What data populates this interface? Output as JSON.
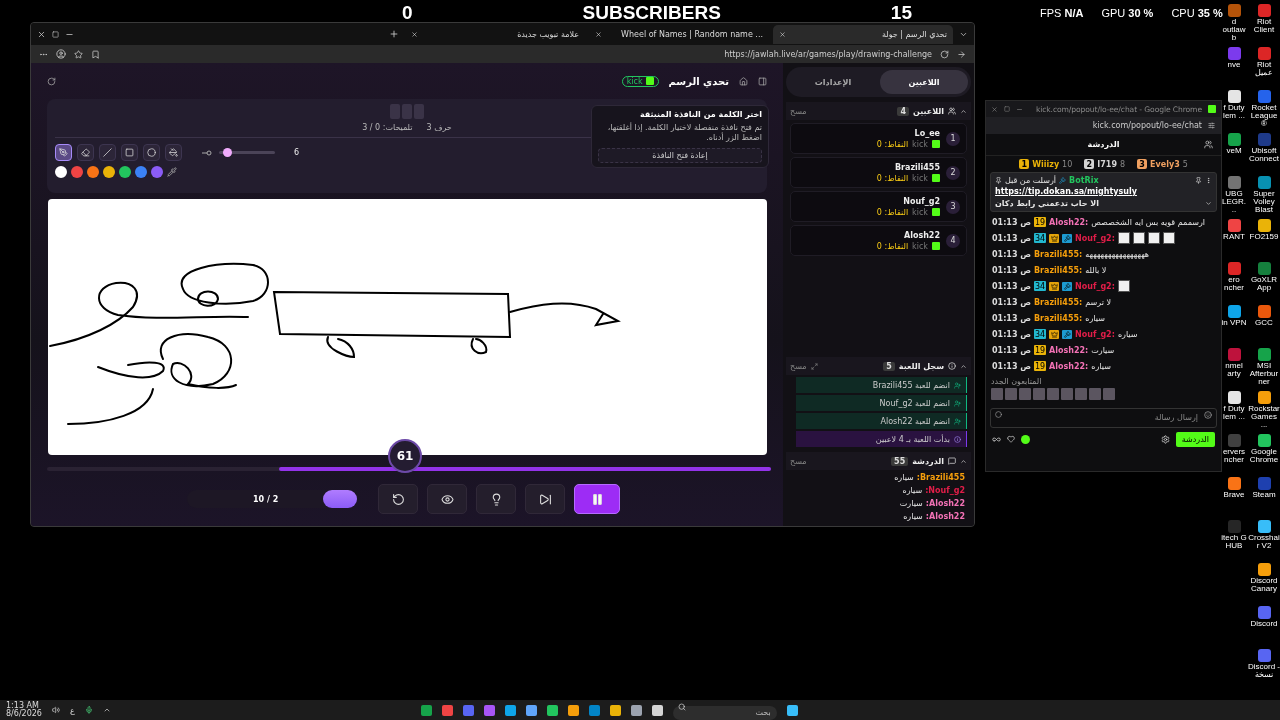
{
  "stream_overlay": {
    "left_count": "0",
    "title": "SUBSCRIBERS",
    "right_count": "15"
  },
  "perf": [
    "CPU **35 %**",
    "GPU **30 %**",
    "FPS **N/A**"
  ],
  "browser": {
    "tabs": [
      {
        "title": "تحدي الرسم | جولة",
        "selected": true
      },
      {
        "title": "Wheel of Names | Random name ...",
        "selected": false
      },
      {
        "title": "علامة تبويب جديدة",
        "selected": false
      }
    ],
    "url": "https://jawlah.live/ar/games/play/drawing-challenge"
  },
  "game": {
    "title": "تحدي الرسم",
    "platform": "kick",
    "word": {
      "letters": "3 حرف",
      "hints": "تلميحات: 0 / 3"
    },
    "tools": [
      {
        "kind": "pen",
        "selected": true
      },
      {
        "kind": "eraser",
        "selected": false
      },
      {
        "kind": "line",
        "selected": false
      },
      {
        "kind": "rect",
        "selected": false
      },
      {
        "kind": "circle",
        "selected": false
      },
      {
        "kind": "fill",
        "selected": false
      }
    ],
    "brush": {
      "level": 0.15,
      "value": "6"
    },
    "colors": [
      {
        "color": "#ffffff",
        "selected": true
      },
      {
        "color": "#ef4444",
        "selected": false
      },
      {
        "color": "#f97316",
        "selected": false
      },
      {
        "color": "#eab308",
        "selected": false
      },
      {
        "color": "#22c55e",
        "selected": false
      },
      {
        "color": "#3b82f6",
        "selected": false
      },
      {
        "color": "#8b5cf6",
        "selected": false
      }
    ],
    "popup": {
      "title": "اختر الكلمة من النافذة المنبثقة",
      "body": "تم فتح نافذة منفصلة لاختيار الكلمة. إذا أغلقتها، اضغط الزر أدناه.",
      "button": "إعادة فتح النافذة"
    },
    "timer": "61",
    "progress": {
      "level": 0.68
    },
    "round": "10 / 2",
    "controls": [
      {
        "kind": "restart",
        "selected": false
      },
      {
        "kind": "reveal",
        "selected": false
      },
      {
        "kind": "hint",
        "selected": false
      },
      {
        "kind": "skip",
        "selected": false
      },
      {
        "kind": "pause",
        "selected": true
      }
    ]
  },
  "sidebar": {
    "tabs": [
      {
        "label": "اللاعبين",
        "selected": true
      },
      {
        "label": "الإعدادات",
        "selected": false
      }
    ],
    "players": {
      "title": "اللاعبين",
      "count": "4",
      "clear": "مسح",
      "items": [
        {
          "rank": "1",
          "name": "Lo_ee",
          "platform": "kick",
          "points": "النقاط: 0"
        },
        {
          "rank": "2",
          "name": "Brazili455",
          "platform": "kick",
          "points": "النقاط: 0"
        },
        {
          "rank": "3",
          "name": "Nouf_g2",
          "platform": "kick",
          "points": "النقاط: 0"
        },
        {
          "rank": "4",
          "name": "Alosh22",
          "platform": "kick",
          "points": "النقاط: 0"
        }
      ]
    },
    "log": {
      "title": "سجل اللعبة",
      "count": "5",
      "clear": "مسح",
      "items": [
        {
          "kind": "join",
          "text": "Brazili455 انضم للعبة"
        },
        {
          "kind": "join",
          "text": "Nouf_g2 انضم للعبة"
        },
        {
          "kind": "join",
          "text": "Alosh22 انضم للعبة"
        },
        {
          "kind": "info",
          "text": "بدأت اللعبة بـ 4 لاعبين"
        }
      ]
    },
    "chat": {
      "title": "الدردشة",
      "count": "55",
      "clear": "مسح",
      "messages": [
        {
          "name": ":Brazili455",
          "color": "#f59e0b",
          "text": "سياره"
        },
        {
          "name": ":Nouf_g2",
          "color": "#e11d48",
          "text": "سياره"
        },
        {
          "name": ":Alosh22",
          "color": "#f472b6",
          "text": "سيارت"
        },
        {
          "name": ":Alosh22",
          "color": "#f472b6",
          "text": "سياره"
        }
      ]
    }
  },
  "kick_chat": {
    "window_title": "kick.com/popout/lo-ee/chat - Google Chrome",
    "url": "kick.com/popout/lo-ee/chat",
    "title": "الدردشة",
    "leaders": [
      {
        "rank": "3",
        "name": "Evely3",
        "score": "5",
        "color": "#f0a060"
      },
      {
        "rank": "2",
        "name": "I719",
        "score": "8",
        "color": "#d4d4d4"
      },
      {
        "rank": "1",
        "name": "Wiiizy",
        "score": "10",
        "color": "#eab308"
      }
    ],
    "pinned": {
      "author": "BotRix",
      "sent_by": "أرسلت من قبل",
      "link": "https://tip.dokan.sa/mightysuly",
      "text": "الا حاب تدعمني رابط دكان"
    },
    "messages": [
      {
        "time": "01:13 ص",
        "badges": [
          {
            "kind": "sub",
            "label": "19",
            "color": "#eab308"
          }
        ],
        "name": "Alosh22:",
        "color": "#f472b6",
        "kind": "text",
        "text": "ارسممم قويه بس ايه الشخصصص"
      },
      {
        "time": "01:13 ص",
        "badges": [
          {
            "kind": "sub",
            "label": "34",
            "color": "#22b8cf"
          },
          {
            "kind": "crown"
          },
          {
            "kind": "mod"
          }
        ],
        "name": "Nouf_g2:",
        "color": "#e11d48",
        "kind": "emote",
        "emotes": [
          {
            "kind": "emote"
          },
          {
            "kind": "emote"
          },
          {
            "kind": "emote"
          },
          {
            "kind": "emote"
          }
        ]
      },
      {
        "time": "01:13 ص",
        "name": "Brazili455:",
        "color": "#f59e0b",
        "kind": "text",
        "text": "ههههههههههههههههه"
      },
      {
        "time": "01:13 ص",
        "name": "Brazili455:",
        "color": "#f59e0b",
        "kind": "text",
        "text": "لا بالله"
      },
      {
        "time": "01:13 ص",
        "badges": [
          {
            "kind": "sub",
            "label": "34",
            "color": "#22b8cf"
          },
          {
            "kind": "crown"
          },
          {
            "kind": "mod"
          }
        ],
        "name": "Nouf_g2:",
        "color": "#e11d48",
        "kind": "emote",
        "emotes": [
          {
            "kind": "emote"
          }
        ]
      },
      {
        "time": "01:13 ص",
        "name": "Brazili455:",
        "color": "#f59e0b",
        "kind": "text",
        "text": "لا ترسم"
      },
      {
        "time": "01:13 ص",
        "name": "Brazili455:",
        "color": "#f59e0b",
        "kind": "text",
        "text": "سياره"
      },
      {
        "time": "01:13 ص",
        "badges": [
          {
            "kind": "sub",
            "label": "34",
            "color": "#22b8cf"
          },
          {
            "kind": "crown"
          },
          {
            "kind": "mod"
          }
        ],
        "name": "Nouf_g2:",
        "color": "#e11d48",
        "kind": "text",
        "text": "سياره"
      },
      {
        "time": "01:13 ص",
        "badges": [
          {
            "kind": "sub",
            "label": "19",
            "color": "#eab308"
          }
        ],
        "name": "Alosh22:",
        "color": "#f472b6",
        "kind": "text",
        "text": "سيارت"
      },
      {
        "time": "01:13 ص",
        "badges": [
          {
            "kind": "sub",
            "label": "19",
            "color": "#eab308"
          }
        ],
        "name": "Alosh22:",
        "color": "#f472b6",
        "kind": "text",
        "text": "سياره"
      }
    ],
    "followers_label": "المتابعون الجدد",
    "input_placeholder": "إرسال رسالة",
    "send_button": "الدردشة"
  },
  "desktop_icons_left": [
    {
      "label": "d outlaw b",
      "color": "#b45309"
    },
    {
      "label": "nve",
      "color": "#7c3aed"
    },
    {
      "label": "f Duty lem ...",
      "color": "#e5e5e5"
    },
    {
      "label": "veM",
      "color": "#16a34a"
    },
    {
      "label": "UBG LEGR...",
      "color": "#737373"
    },
    {
      "label": "RANT",
      "color": "#ef4444"
    },
    {
      "label": "ero ncher",
      "color": "#dc2626"
    },
    {
      "label": "in VPN",
      "color": "#0ea5e9"
    },
    {
      "label": "nmel arty",
      "color": "#be123c"
    },
    {
      "label": "f Duty lem ...",
      "color": "#e5e5e5"
    },
    {
      "label": "ervers ncher",
      "color": "#404040"
    },
    {
      "label": "Brave",
      "color": "#f97316"
    },
    {
      "label": "itech G HUB",
      "color": "#262626"
    }
  ],
  "desktop_icons_right": [
    {
      "label": "Riot Client",
      "color": "#dc2626"
    },
    {
      "label": "Riot عميل",
      "color": "#dc2626"
    },
    {
      "label": "Rocket League®",
      "color": "#2563eb"
    },
    {
      "label": "Ubisoft Connect",
      "color": "#1e3a8a"
    },
    {
      "label": "Super Volley Blast",
      "color": "#0891b2"
    },
    {
      "label": "FO2159",
      "color": "#eab308"
    },
    {
      "label": "GoXLR App",
      "color": "#15803d"
    },
    {
      "label": "GCC",
      "color": "#ea580c"
    },
    {
      "label": "MSI Afterburner",
      "color": "#16a34a"
    },
    {
      "label": "Rockstar Games ...",
      "color": "#f59e0b"
    },
    {
      "label": "Google Chrome",
      "color": "#22c55e"
    },
    {
      "label": "Steam",
      "color": "#1e40af"
    },
    {
      "label": "Crosshair V2",
      "color": "#38bdf8"
    },
    {
      "label": "Discord Canary",
      "color": "#f59e0b"
    },
    {
      "label": "Discord",
      "color": "#5865f2"
    },
    {
      "label": "Discord - نسخة",
      "color": "#5865f2"
    }
  ],
  "taskbar": {
    "time": "1:13 AM",
    "date": "8/6/2026",
    "language": "ع",
    "search_placeholder": "بحث"
  }
}
